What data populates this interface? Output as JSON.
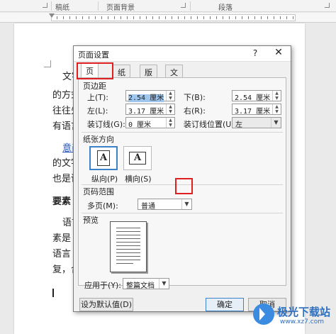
{
  "ribbon": {
    "groups": [
      "稿纸",
      "页面背景",
      "段落"
    ]
  },
  "document": {
    "lines": [
      {
        "text": "文字"
      },
      {
        "text": "的方式"
      },
      {
        "text": "往往先"
      },
      {
        "text": "有语言"
      },
      {
        "text": "意義"
      },
      {
        "text": "的文字"
      },
      {
        "text": "也是语"
      },
      {
        "text": "要素"
      },
      {
        "text": "语言"
      },
      {
        "text": "素是"
      },
      {
        "text": "语言"
      },
      {
        "text": "复，合"
      }
    ]
  },
  "dialog": {
    "title": "页面设置",
    "help": "?",
    "close": "✕",
    "tabs": [
      {
        "label": "页边距",
        "active": true
      },
      {
        "label": "纸张",
        "active": false
      },
      {
        "label": "版式",
        "active": false
      },
      {
        "label": "文档网格",
        "active": false
      }
    ],
    "margins": {
      "section_title": "页边距",
      "top_label": "上(T):",
      "top_value": "2.54 厘米",
      "bottom_label": "下(B):",
      "bottom_value": "2.54 厘米",
      "left_label": "左(L):",
      "left_value": "3.17 厘米",
      "right_label": "右(R):",
      "right_value": "3.17 厘米",
      "gutter_label": "装订线(G):",
      "gutter_value": "0 厘米",
      "gutter_pos_label": "装订线位置(U):",
      "gutter_pos_value": "左"
    },
    "orientation": {
      "section_title": "纸张方向",
      "portrait_label": "纵向(P)",
      "landscape_label": "横向(S)",
      "selected": "portrait"
    },
    "pages": {
      "section_title": "页码范围",
      "multiple_label": "多页(M):",
      "multiple_value": "普通"
    },
    "preview": {
      "section_title": "预览",
      "apply_label": "应用于(Y):",
      "apply_value": "整篇文档"
    },
    "buttons": {
      "default": "设为默认值(D)",
      "ok": "确定",
      "cancel": "取消"
    }
  },
  "watermark": {
    "name": "极光下载站",
    "url": "www.xz7.com"
  }
}
